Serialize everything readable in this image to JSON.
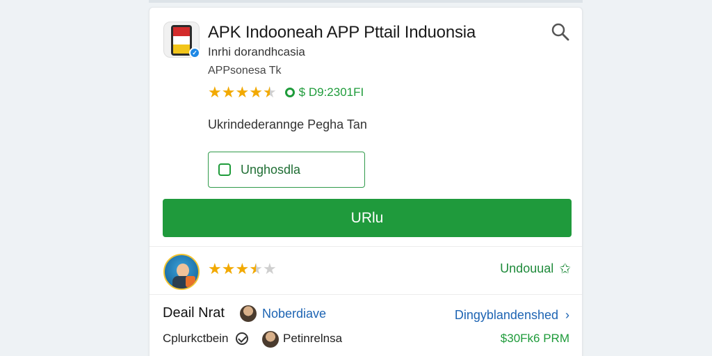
{
  "app": {
    "title": "APK Indooneah APP Pttail Induonsia",
    "subtitle": "Inrhi dorandhcasia",
    "subline": "APPsonesa Tk",
    "rating_value": 4.5,
    "price_text": "$ D9:2301FI",
    "description": "Ukrindederannge Pegha Tan",
    "outline_button": "Unghosdla",
    "primary_button": "URlu"
  },
  "review": {
    "rating_value": 3.5,
    "download_label": "Undouual"
  },
  "details": {
    "label": "Deail Nrat",
    "author": "Noberdiave",
    "share_label": "Dingyblandenshed"
  },
  "footer": {
    "left_label": "Cplurkctbein",
    "name": "Petinrelnsa",
    "price": "$30Fk6 PRM"
  },
  "colors": {
    "accent_green": "#1f9a3c",
    "link_blue": "#1d64b3",
    "star_gold": "#f2a900"
  },
  "icons": {
    "search": "search-icon",
    "verified": "verified-badge-icon",
    "price": "price-tag-icon",
    "outline_button": "square-icon",
    "download_star": "star-outline-icon",
    "chevron": "chevron-right-icon",
    "check": "check-circle-icon"
  }
}
